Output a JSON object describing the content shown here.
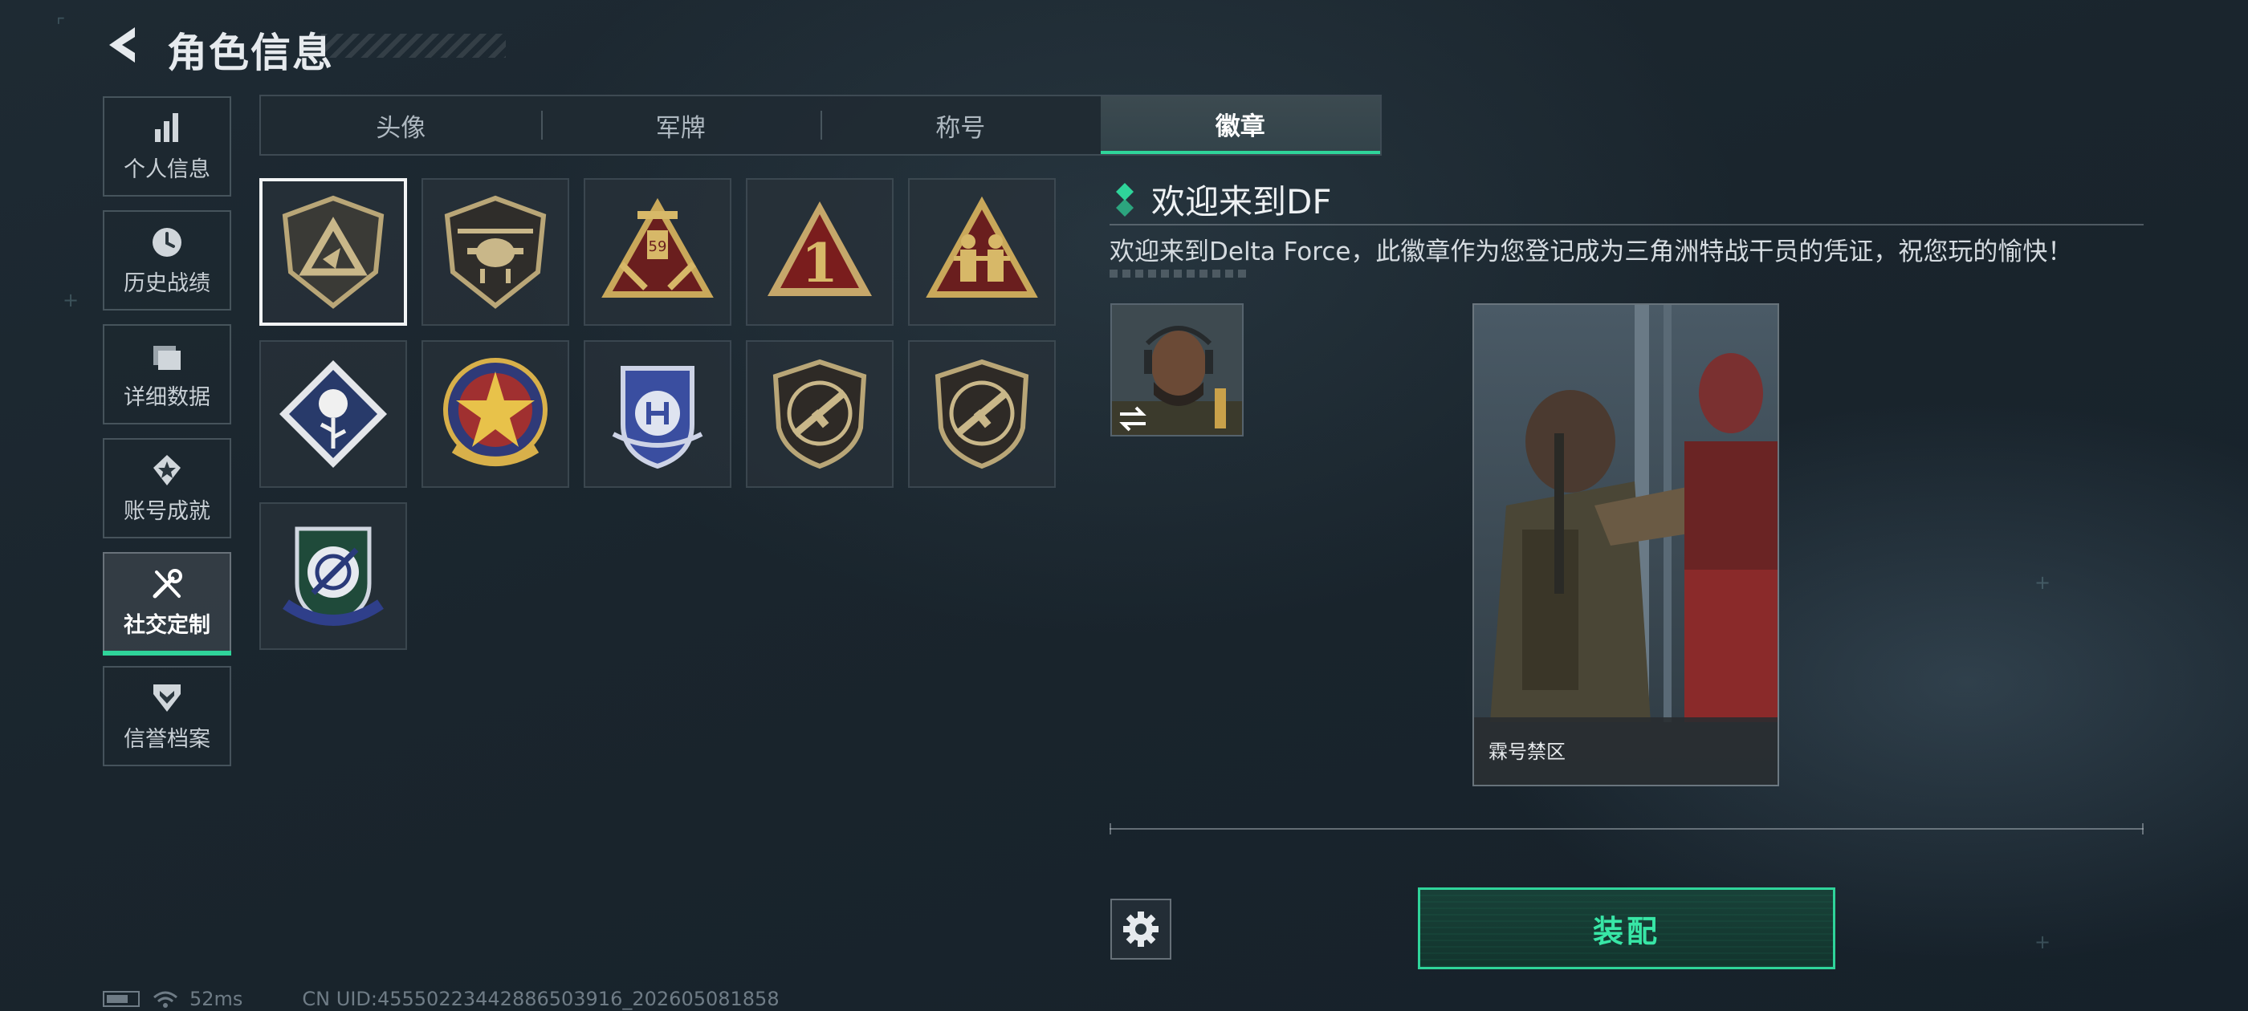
{
  "header": {
    "title": "角色信息"
  },
  "sidebar": {
    "items": [
      {
        "label": "个人信息",
        "icon": "bar-chart-icon",
        "active": false
      },
      {
        "label": "历史战绩",
        "icon": "clock-icon",
        "active": false
      },
      {
        "label": "详细数据",
        "icon": "folder-icon",
        "active": false
      },
      {
        "label": "账号成就",
        "icon": "medal-star-icon",
        "active": false
      },
      {
        "label": "社交定制",
        "icon": "wrench-screwdriver-icon",
        "active": true
      },
      {
        "label": "信誉档案",
        "icon": "shield-chevron-icon",
        "active": false
      }
    ]
  },
  "tabs": [
    {
      "label": "头像",
      "active": false
    },
    {
      "label": "军牌",
      "active": false
    },
    {
      "label": "称号",
      "active": false
    },
    {
      "label": "徽章",
      "active": true
    }
  ],
  "badges": [
    {
      "icon": "delta-shield-badge-icon",
      "selected": true
    },
    {
      "icon": "helicopter-badge-icon",
      "selected": false
    },
    {
      "icon": "numbered-59-badge-icon",
      "selected": false
    },
    {
      "icon": "number-one-triangle-badge-icon",
      "selected": false
    },
    {
      "icon": "soldiers-triangle-badge-icon",
      "selected": false
    },
    {
      "icon": "rose-diamond-badge-icon",
      "selected": false
    },
    {
      "icon": "star-roundel-badge-icon",
      "selected": false
    },
    {
      "icon": "blue-crest-badge-icon",
      "selected": false
    },
    {
      "icon": "rifle-shield-badge-icon",
      "selected": false
    },
    {
      "icon": "rifle-shield-badge-icon",
      "selected": false
    },
    {
      "icon": "crosshair-knife-badge-icon",
      "selected": false
    }
  ],
  "detail": {
    "title": "欢迎来到DF",
    "description": "欢迎来到Delta Force，此徽章作为您登记成为三角洲特战干员的凭证，祝您玩的愉快！",
    "card_caption": "霖号禁区"
  },
  "actions": {
    "equip_label": "装配"
  },
  "footer": {
    "ping": "52ms",
    "uid": "CN UID:4555022344288650391​6_202605081858"
  },
  "colors": {
    "accent": "#2fd49a",
    "background": "#1b262e"
  }
}
